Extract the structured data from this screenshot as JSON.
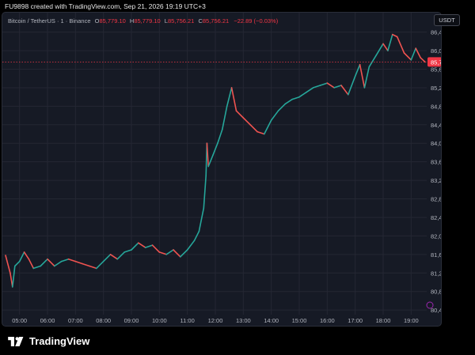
{
  "header": {
    "attribution": "FU9898 created with TradingView.com, Sep 21, 2026 19:19 UTC+3"
  },
  "legend": {
    "symbol": "Bitcoin / TetherUS · 1 · Binance",
    "open_label": "O",
    "open_value": "85,779.10",
    "high_label": "H",
    "high_value": "85,779.10",
    "low_label": "L",
    "low_value": "85,756.21",
    "close_label": "C",
    "close_value": "85,756.21",
    "change": "−22.89 (−0.03%)"
  },
  "currency": "USDT",
  "footer": {
    "brand": "TradingView"
  },
  "colors": {
    "up": "#26a69a",
    "down": "#ef5350",
    "price_tag": "#f23645",
    "grid": "#242733",
    "text": "#b2b5be"
  },
  "chart_data": {
    "type": "line",
    "title": "",
    "xlabel": "",
    "ylabel": "",
    "grid": true,
    "x_ticks": [
      "05:00",
      "06:00",
      "07:00",
      "08:00",
      "09:00",
      "10:00",
      "11:00",
      "12:00",
      "13:00",
      "14:00",
      "15:00",
      "16:00",
      "17:00",
      "18:00",
      "19:00"
    ],
    "y_ticks": [
      "86,400.00",
      "86,000.00",
      "85,600.00",
      "85,200.00",
      "84,800.00",
      "84,400.00",
      "84,000.00",
      "83,600.00",
      "83,200.00",
      "82,800.00",
      "82,400.00",
      "82,000.00",
      "81,600.00",
      "81,200.00",
      "80,800.00",
      "80,400.00"
    ],
    "ylim": [
      80300,
      86650
    ],
    "last_price": 85756.21,
    "last_price_label": "85,756.21",
    "series": [
      {
        "values": [
          [
            "04:30",
            81580
          ],
          [
            "04:40",
            81200
          ],
          [
            "04:45",
            80900
          ],
          [
            "04:50",
            81350
          ],
          [
            "05:00",
            81450
          ],
          [
            "05:10",
            81650
          ],
          [
            "05:20",
            81500
          ],
          [
            "05:30",
            81300
          ],
          [
            "05:45",
            81350
          ],
          [
            "06:00",
            81500
          ],
          [
            "06:15",
            81350
          ],
          [
            "06:30",
            81450
          ],
          [
            "06:45",
            81500
          ],
          [
            "07:00",
            81450
          ],
          [
            "07:15",
            81400
          ],
          [
            "07:30",
            81350
          ],
          [
            "07:45",
            81300
          ],
          [
            "08:00",
            81450
          ],
          [
            "08:15",
            81600
          ],
          [
            "08:30",
            81500
          ],
          [
            "08:45",
            81650
          ],
          [
            "09:00",
            81700
          ],
          [
            "09:15",
            81850
          ],
          [
            "09:30",
            81750
          ],
          [
            "09:45",
            81800
          ],
          [
            "10:00",
            81650
          ],
          [
            "10:15",
            81600
          ],
          [
            "10:30",
            81700
          ],
          [
            "10:45",
            81550
          ],
          [
            "11:00",
            81700
          ],
          [
            "11:15",
            81900
          ],
          [
            "11:25",
            82100
          ],
          [
            "11:35",
            82600
          ],
          [
            "11:40",
            83300
          ],
          [
            "11:42",
            84000
          ],
          [
            "11:45",
            83500
          ],
          [
            "11:55",
            83750
          ],
          [
            "12:05",
            84000
          ],
          [
            "12:15",
            84300
          ],
          [
            "12:25",
            84800
          ],
          [
            "12:35",
            85200
          ],
          [
            "12:45",
            84700
          ],
          [
            "13:00",
            84550
          ],
          [
            "13:15",
            84400
          ],
          [
            "13:30",
            84250
          ],
          [
            "13:45",
            84200
          ],
          [
            "14:00",
            84500
          ],
          [
            "14:15",
            84700
          ],
          [
            "14:30",
            84850
          ],
          [
            "14:45",
            84950
          ],
          [
            "15:00",
            85000
          ],
          [
            "15:15",
            85100
          ],
          [
            "15:30",
            85200
          ],
          [
            "15:45",
            85250
          ],
          [
            "16:00",
            85300
          ],
          [
            "16:15",
            85200
          ],
          [
            "16:30",
            85250
          ],
          [
            "16:45",
            85050
          ],
          [
            "17:00",
            85450
          ],
          [
            "17:10",
            85700
          ],
          [
            "17:20",
            85200
          ],
          [
            "17:30",
            85650
          ],
          [
            "17:45",
            85900
          ],
          [
            "18:00",
            86150
          ],
          [
            "18:10",
            86000
          ],
          [
            "18:20",
            86350
          ],
          [
            "18:30",
            86300
          ],
          [
            "18:45",
            85950
          ],
          [
            "19:00",
            85800
          ],
          [
            "19:10",
            86050
          ],
          [
            "19:20",
            85850
          ],
          [
            "19:30",
            85756.21
          ]
        ]
      }
    ]
  }
}
